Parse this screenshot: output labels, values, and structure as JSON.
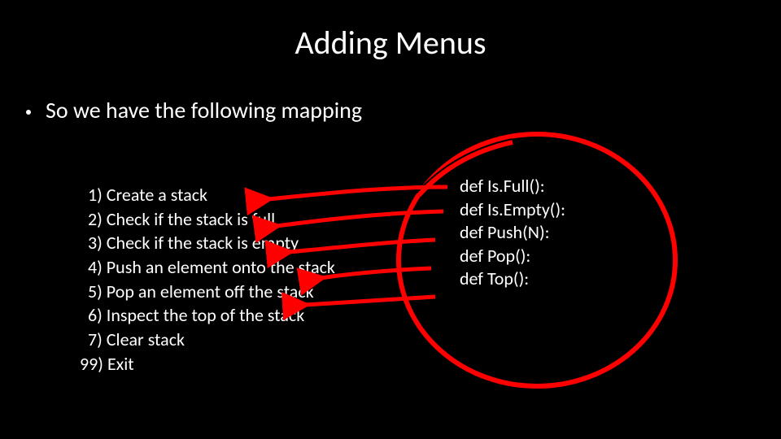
{
  "title": "Adding Menus",
  "bullet": "So we have the following mapping",
  "menu": {
    "i1": "1) Create a stack",
    "i2": "2) Check if the stack is full",
    "i3": "3) Check if the stack is empty",
    "i4": "4) Push an element onto the stack",
    "i5": "5) Pop an element off the stack",
    "i6": "6) Inspect the top of the stack",
    "i7": "7) Clear stack",
    "i99": "99) Exit"
  },
  "code": {
    "l1": "def Is.Full():",
    "l2": "def Is.Empty():",
    "l3": "def Push(N):",
    "l4": "def Pop():",
    "l5": "def Top():"
  }
}
